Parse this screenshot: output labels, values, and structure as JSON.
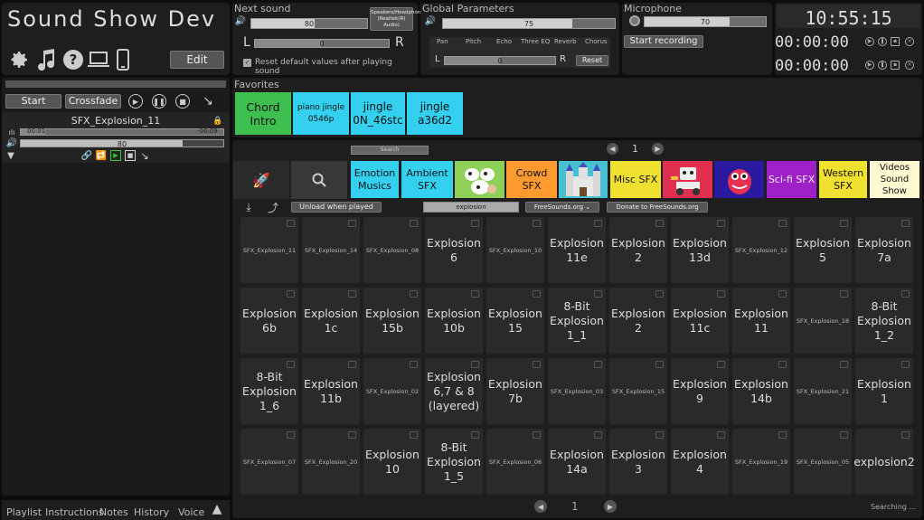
{
  "app": {
    "title": "Sound Show Dev",
    "edit_label": "Edit"
  },
  "player": {
    "start_label": "Start",
    "crossfade_label": "Crossfade",
    "track_name": "SFX_Explosion_11",
    "elapsed": "00:01",
    "remaining": "-00:09",
    "progress": 0.12,
    "volume_value": "80",
    "volume": 0.8
  },
  "next_sound": {
    "title": "Next sound",
    "volume_value": "80",
    "volume": 0.55,
    "speakers_label": "Speakers/Headphones (Realtek(R) Audio)",
    "balance_value": "0",
    "left": "L",
    "right": "R",
    "reset_label": "Reset default values after playing sound",
    "reset_checked": true
  },
  "global": {
    "title": "Global Parameters",
    "volume_value": "75",
    "volume": 0.75,
    "tabs": [
      "Pan",
      "Pitch",
      "Echo",
      "Three EQ",
      "Reverb",
      "Chorus"
    ],
    "pan_value": "0",
    "left": "L",
    "right": "R",
    "reset_label": "Reset"
  },
  "microphone": {
    "title": "Microphone",
    "volume_value": "70",
    "volume": 0.7,
    "record_label": "Start recording"
  },
  "clock": {
    "time": "10:55:15",
    "timer1": "00:00:00",
    "timer2": "00:00:00"
  },
  "favorites": {
    "title": "Favorites",
    "items": [
      {
        "label": "Chord Intro",
        "color": "#3fbf4f"
      },
      {
        "label": "piano jingle 0546p",
        "color": "#33d0f0"
      },
      {
        "label": "jingle 0N_46stc",
        "color": "#33d0f0"
      },
      {
        "label": "jingle a36d2",
        "color": "#33d0f0"
      }
    ]
  },
  "browser": {
    "page": "1",
    "search_value": "explosion",
    "unload_label": "Unload when played",
    "source_label": "FreeSounds.org",
    "donate_label": "Donate to FreeSounds.org",
    "bottom_page": "1",
    "status": "Searching ...",
    "categories": [
      {
        "label": "Emotion Musics",
        "color": "#33d0f0",
        "text": "#111"
      },
      {
        "label": "Ambient SFX",
        "color": "#33d0f0",
        "text": "#111"
      },
      {
        "label": "",
        "color": "#8fd05a",
        "text": "#111",
        "icon": "cow-icon"
      },
      {
        "label": "Crowd SFX",
        "color": "#ff9a30",
        "text": "#111"
      },
      {
        "label": "",
        "color": "#47c0d0",
        "text": "#111",
        "icon": "castle-icon"
      },
      {
        "label": "Misc SFX",
        "color": "#f0e030",
        "text": "#111"
      },
      {
        "label": "",
        "color": "#e03050",
        "text": "#111",
        "icon": "robot-icon"
      },
      {
        "label": "",
        "color": "#2a1aa0",
        "text": "#111",
        "icon": "monster-icon"
      },
      {
        "label": "Sci-fi SFX",
        "color": "#a020c8",
        "text": "#eee"
      },
      {
        "label": "Western SFX",
        "color": "#f0e030",
        "text": "#111"
      },
      {
        "label": "Videos Sound Show",
        "color": "#fff8d0",
        "text": "#111"
      }
    ],
    "sounds": [
      {
        "label": "SFX_Explosion_11",
        "small": true
      },
      {
        "label": "SFX_Explosion_14",
        "small": true
      },
      {
        "label": "SFX_Explosion_08",
        "small": true
      },
      {
        "label": "Explosion 6",
        "small": false
      },
      {
        "label": "SFX_Explosion_10",
        "small": true
      },
      {
        "label": "Explosion 11e",
        "small": false
      },
      {
        "label": "Explosion 2",
        "small": false
      },
      {
        "label": "Explosion 13d",
        "small": false
      },
      {
        "label": "SFX_Explosion_12",
        "small": true
      },
      {
        "label": "Explosion 5",
        "small": false
      },
      {
        "label": "Explosion 7a",
        "small": false
      },
      {
        "label": "Explosion 6b",
        "small": false
      },
      {
        "label": "Explosion 1c",
        "small": false
      },
      {
        "label": "Explosion 15b",
        "small": false
      },
      {
        "label": "Explosion 10b",
        "small": false
      },
      {
        "label": "Explosion 15",
        "small": false
      },
      {
        "label": "8-Bit Explosion 1_1",
        "small": false
      },
      {
        "label": "Explosion 2",
        "small": false
      },
      {
        "label": "Explosion 11c",
        "small": false
      },
      {
        "label": "Explosion 11",
        "small": false
      },
      {
        "label": "SFX_Explosion_18",
        "small": true
      },
      {
        "label": "8-Bit Explosion 1_2",
        "small": false
      },
      {
        "label": "8-Bit Explosion 1_6",
        "small": false
      },
      {
        "label": "Explosion 11b",
        "small": false
      },
      {
        "label": "SFX_Explosion_02",
        "small": true
      },
      {
        "label": "Explosion 6,7 & 8 (layered)",
        "small": false
      },
      {
        "label": "Explosion 7b",
        "small": false
      },
      {
        "label": "SFX_Explosion_03",
        "small": true
      },
      {
        "label": "SFX_Explosion_15",
        "small": true
      },
      {
        "label": "Explosion 9",
        "small": false
      },
      {
        "label": "Explosion 14b",
        "small": false
      },
      {
        "label": "SFX_Explosion_21",
        "small": true
      },
      {
        "label": "Explosion 1",
        "small": false
      },
      {
        "label": "SFX_Explosion_07",
        "small": true
      },
      {
        "label": "SFX_Explosion_20",
        "small": true
      },
      {
        "label": "Explosion 10",
        "small": false
      },
      {
        "label": "8-Bit Explosion 1_5",
        "small": false
      },
      {
        "label": "SFX_Explosion_06",
        "small": true
      },
      {
        "label": "Explosion 14a",
        "small": false
      },
      {
        "label": "Explosion 3",
        "small": false
      },
      {
        "label": "Explosion 4",
        "small": false
      },
      {
        "label": "SFX_Explosion_19",
        "small": true
      },
      {
        "label": "SFX_Explosion_05",
        "small": true
      },
      {
        "label": "explosion2",
        "small": false
      }
    ]
  },
  "bottom_tabs": [
    "Playlist",
    "Instructions",
    "Notes",
    "History",
    "Voice"
  ]
}
